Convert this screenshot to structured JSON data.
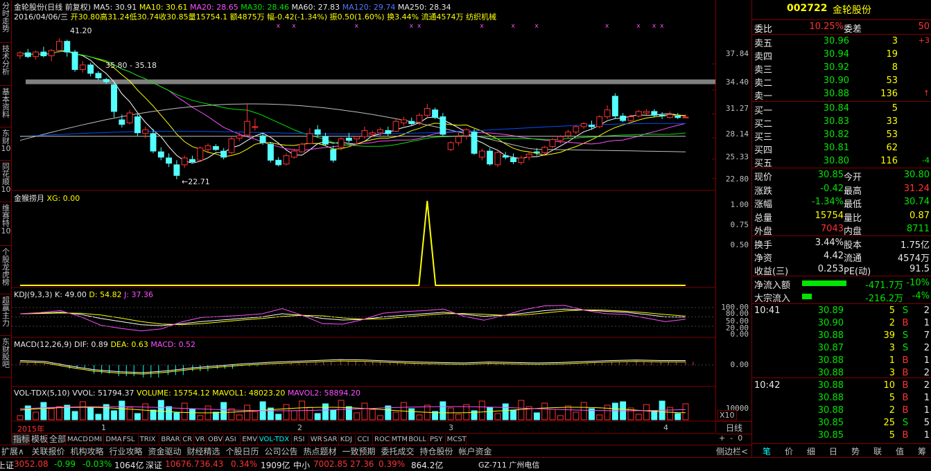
{
  "left_tabs": [
    "分时走势",
    "技术分析",
    "基本资料",
    "东财10",
    "同花顺10",
    "维赛特10",
    "个股龙虎榜",
    "超赢主力",
    "东财股吧"
  ],
  "main": {
    "title_prefix": "金轮股份(日线 前复权)",
    "ma5": "MA5: 30.91",
    "ma10": "MA10: 30.61",
    "ma20": "MA20: 28.65",
    "ma30": "MA30: 28.46",
    "ma60": "MA60: 27.83",
    "ma120": "MA120: 29.74",
    "ma250": "MA250: 28.34",
    "info_date": "2016/04/06/三",
    "info_open": "开30.80",
    "info_high": "高31.24",
    "info_low": "低30.74",
    "info_close": "收30.85",
    "info_vol": "量15754.1",
    "info_amt": "额4875万",
    "info_chg": "幅-0.42(-1.34%)",
    "info_amp": "振0.50(1.60%)",
    "info_turn": "换3.44%",
    "info_float": "流通4574万",
    "info_ind": "纺织机械",
    "annot_high": "41.20",
    "annot_range": "35.80 - 35.18",
    "annot_low": "←22.71",
    "y_labels": [
      "37.84",
      "34.40",
      "31.27",
      "28.14",
      "25.33",
      "22.80"
    ]
  },
  "panel_jh": {
    "title": "金猴捞月",
    "xg": "XG: 0.00",
    "y_labels": [
      "1.00",
      "0.75",
      "0.50"
    ]
  },
  "panel_kdj": {
    "title": "KDJ(9,3,3)",
    "k": "K: 49.00",
    "d": "D: 54.82",
    "j": "J: 37.36",
    "y_labels": [
      "100.00",
      "80.00",
      "50.00",
      "20.00",
      "0.00"
    ]
  },
  "panel_macd": {
    "title": "MACD(12,26,9)",
    "dif": "DIF: 0.89",
    "dea": "DEA: 0.63",
    "macd": "MACD: 0.52",
    "y_labels": [
      "0.00"
    ]
  },
  "panel_vol": {
    "title": "VOL-TDX(5,10)",
    "vvol": "VVOL: 51794.37",
    "volume": "VOLUME: 15754.12",
    "mavol1": "MAVOL1: 48023.20",
    "mavol2": "MAVOL2: 58894.20",
    "y_labels": [
      "10000"
    ],
    "unit": "X10"
  },
  "x_axis": [
    "2015年",
    "1",
    "2",
    "3",
    "4"
  ],
  "bottom_tabs": [
    "指标",
    "模板",
    "全部",
    "MACD",
    "DMI",
    "DMA",
    "FSL",
    "TRIX",
    "BRAR",
    "CR",
    "VR",
    "OBV",
    "ASI",
    "EMV",
    "VOL-TDX",
    "RSI",
    "WR",
    "SAR",
    "KDJ",
    "CCI",
    "ROC",
    "MTM",
    "BOLL",
    "PSY",
    "MCST"
  ],
  "period_label": "日线",
  "menu": [
    "扩展∧",
    "关联报价",
    "机构攻略",
    "行业攻略",
    "资金驱动",
    "财经精选",
    "个股日历",
    "公司公告",
    "热点题材",
    "一致预期",
    "委托成交",
    "持仓股份",
    "帐户资金"
  ],
  "menu_right": "侧边栏<",
  "stock": {
    "code": "002722",
    "name": "金轮股份"
  },
  "order_ratio": {
    "label1": "委比",
    "val1": "10.25%",
    "label2": "委差",
    "val2": "50"
  },
  "sells": [
    {
      "label": "卖五",
      "price": "30.96",
      "vol": "3",
      "chg": "+3"
    },
    {
      "label": "卖四",
      "price": "30.94",
      "vol": "19",
      "chg": ""
    },
    {
      "label": "卖三",
      "price": "30.92",
      "vol": "8",
      "chg": ""
    },
    {
      "label": "卖二",
      "price": "30.90",
      "vol": "53",
      "chg": ""
    },
    {
      "label": "卖一",
      "price": "30.88",
      "vol": "136",
      "chg": "↑"
    }
  ],
  "buys": [
    {
      "label": "买一",
      "price": "30.84",
      "vol": "5",
      "chg": ""
    },
    {
      "label": "买二",
      "price": "30.83",
      "vol": "33",
      "chg": ""
    },
    {
      "label": "买三",
      "price": "30.82",
      "vol": "53",
      "chg": ""
    },
    {
      "label": "买四",
      "price": "30.81",
      "vol": "62",
      "chg": ""
    },
    {
      "label": "买五",
      "price": "30.80",
      "vol": "116",
      "chg": "-4"
    }
  ],
  "quote": [
    {
      "l1": "现价",
      "v1": "30.85",
      "l2": "今开",
      "v2": "30.80"
    },
    {
      "l1": "涨跌",
      "v1": "-0.42",
      "l2": "最高",
      "v2": "31.24"
    },
    {
      "l1": "涨幅",
      "v1": "-1.34%",
      "l2": "最低",
      "v2": "30.74"
    },
    {
      "l1": "总量",
      "v1": "15754",
      "l2": "量比",
      "v2": "0.87"
    },
    {
      "l1": "外盘",
      "v1": "7043",
      "l2": "内盘",
      "v2": "8711"
    }
  ],
  "fund": [
    {
      "l1": "换手",
      "v1": "3.44%",
      "l2": "股本",
      "v2": "1.75亿"
    },
    {
      "l1": "净资",
      "v1": "4.42",
      "l2": "流通",
      "v2": "4574万"
    },
    {
      "l1": "收益(三)",
      "v1": "0.253",
      "l2": "PE(动)",
      "v2": "91.5"
    }
  ],
  "flows": [
    {
      "label": "净流入额",
      "value": "-471.7万",
      "pct": "-10%",
      "bar_fraction": 0.92
    },
    {
      "label": "大宗流入",
      "value": "-216.2万",
      "pct": "-4%",
      "bar_fraction": 0.2
    }
  ],
  "ticks": [
    {
      "time": "10:41",
      "price": "30.89",
      "vol": "5",
      "side": "S",
      "n": "2"
    },
    {
      "time": "",
      "price": "30.90",
      "vol": "2",
      "side": "B",
      "n": "1"
    },
    {
      "time": "",
      "price": "30.88",
      "vol": "39",
      "side": "S",
      "n": "7"
    },
    {
      "time": "",
      "price": "30.87",
      "vol": "3",
      "side": "S",
      "n": "2"
    },
    {
      "time": "",
      "price": "30.88",
      "vol": "1",
      "side": "B",
      "n": "1"
    },
    {
      "time": "",
      "price": "30.88",
      "vol": "3",
      "side": "B",
      "n": "2"
    },
    {
      "time": "10:42",
      "price": "30.88",
      "vol": "10",
      "side": "B",
      "n": "2"
    },
    {
      "time": "",
      "price": "30.88",
      "vol": "5",
      "side": "B",
      "n": "1"
    },
    {
      "time": "",
      "price": "30.88",
      "vol": "2",
      "side": "B",
      "n": "1"
    },
    {
      "time": "",
      "price": "30.85",
      "vol": "25",
      "side": "S",
      "n": "5"
    },
    {
      "time": "",
      "price": "30.85",
      "vol": "5",
      "side": "B",
      "n": "1"
    }
  ],
  "right_tabs": [
    "笔",
    "价",
    "细",
    "日",
    "势",
    "联",
    "值",
    "筹"
  ],
  "status": {
    "sh_label": "上证",
    "sh_val": "3052.08",
    "sh_chg": "-0.99",
    "sh_pct": "-0.03%",
    "sh_amt": "1064亿",
    "sz_label": "深证",
    "sz_val": "10676.7",
    "sz_chg": "36.43",
    "sz_pct": "0.34%",
    "sz_amt": "1909亿",
    "zx_label": "中小",
    "zx_val": "7002.85",
    "zx_chg": "27.36",
    "zx_pct": "0.39%",
    "zx_amt": "864.2亿",
    "server": "GZ-711 广州电信"
  },
  "colors": {
    "up": "#ff3232",
    "down": "#54ffff",
    "border": "#800000",
    "ma5": "#ffffff",
    "ma10": "#ffff00",
    "ma20": "#ff50ff",
    "ma30": "#00e600",
    "ma60": "#c0c0c0",
    "ma120": "#0050ff"
  },
  "chart_data": {
    "type": "candlestick",
    "title": "金轮股份(日线 前复权)",
    "ylim": [
      21.5,
      43.5
    ],
    "candles": [
      [
        38.9,
        39.5,
        38.5,
        39.3
      ],
      [
        39.3,
        39.8,
        38.6,
        38.8
      ],
      [
        38.8,
        39.6,
        38.4,
        39.4
      ],
      [
        39.4,
        40.1,
        38.7,
        38.9
      ],
      [
        38.9,
        39.8,
        38.2,
        39.6
      ],
      [
        39.6,
        41.2,
        39.3,
        40.8
      ],
      [
        40.8,
        41.0,
        38.8,
        39.4
      ],
      [
        39.4,
        39.7,
        36.8,
        37.1
      ],
      [
        37.1,
        38.2,
        36.7,
        37.7
      ],
      [
        37.7,
        38.0,
        36.2,
        36.6
      ],
      [
        36.6,
        36.9,
        35.7,
        36.0
      ],
      [
        35.8,
        36.0,
        35.2,
        35.5
      ],
      [
        35.1,
        35.3,
        30.8,
        31.6
      ],
      [
        30.5,
        31.2,
        29.5,
        29.9
      ],
      [
        30.1,
        31.8,
        29.9,
        31.4
      ],
      [
        30.9,
        31.3,
        28.4,
        28.8
      ],
      [
        28.7,
        29.6,
        28.1,
        29.2
      ],
      [
        28.7,
        29.3,
        26.1,
        26.4
      ],
      [
        26.3,
        26.9,
        25.2,
        25.6
      ],
      [
        25.5,
        26.1,
        24.3,
        24.8
      ],
      [
        24.6,
        25.2,
        22.7,
        23.2
      ],
      [
        24.6,
        25.8,
        24.2,
        25.5
      ],
      [
        25.3,
        25.8,
        24.8,
        25.0
      ],
      [
        25.2,
        27.0,
        25.0,
        26.8
      ],
      [
        26.6,
        27.4,
        26.3,
        27.1
      ],
      [
        27.0,
        27.3,
        26.4,
        26.6
      ],
      [
        26.4,
        26.8,
        25.3,
        25.6
      ],
      [
        26.2,
        28.4,
        26.0,
        28.0
      ],
      [
        28.1,
        28.8,
        27.7,
        28.4
      ],
      [
        28.5,
        32.6,
        28.4,
        30.3
      ],
      [
        29.5,
        30.7,
        29.1,
        29.6
      ],
      [
        28.4,
        28.7,
        27.2,
        27.5
      ],
      [
        27.3,
        27.6,
        24.9,
        25.2
      ],
      [
        25.2,
        25.6,
        24.4,
        24.6
      ],
      [
        24.7,
        26.1,
        24.5,
        25.8
      ],
      [
        25.6,
        26.7,
        25.4,
        26.4
      ],
      [
        26.3,
        27.5,
        26.2,
        27.3
      ],
      [
        27.4,
        29.4,
        27.3,
        28.7
      ],
      [
        29.2,
        29.8,
        28.2,
        28.6
      ],
      [
        28.3,
        28.8,
        27.1,
        27.3
      ],
      [
        26.6,
        27.1,
        24.9,
        25.2
      ],
      [
        26.9,
        28.2,
        26.5,
        28.0
      ],
      [
        28.1,
        28.8,
        27.5,
        27.8
      ],
      [
        28.0,
        28.4,
        27.1,
        28.3
      ],
      [
        28.3,
        29.6,
        28.0,
        29.1
      ],
      [
        28.6,
        29.1,
        28.2,
        28.8
      ],
      [
        28.8,
        29.5,
        28.3,
        29.2
      ],
      [
        29.1,
        29.6,
        28.4,
        28.7
      ],
      [
        29.0,
        30.6,
        28.9,
        30.3
      ],
      [
        30.1,
        30.9,
        29.7,
        30.5
      ],
      [
        30.3,
        30.8,
        29.8,
        30.0
      ],
      [
        30.2,
        31.4,
        29.8,
        31.1
      ],
      [
        31.1,
        32.6,
        30.8,
        32.0
      ],
      [
        31.8,
        32.1,
        30.6,
        30.8
      ],
      [
        30.9,
        31.4,
        28.4,
        28.6
      ],
      [
        26.6,
        27.7,
        26.4,
        27.5
      ],
      [
        27.5,
        28.8,
        27.1,
        28.3
      ],
      [
        28.4,
        29.4,
        27.9,
        29.2
      ],
      [
        28.9,
        29.3,
        25.9,
        26.1
      ],
      [
        25.6,
        26.7,
        25.2,
        26.4
      ],
      [
        26.4,
        26.8,
        24.5,
        24.7
      ],
      [
        24.6,
        26.5,
        24.3,
        26.2
      ],
      [
        25.8,
        26.3,
        25.3,
        25.6
      ],
      [
        25.5,
        26.1,
        24.7,
        25.0
      ],
      [
        24.9,
        25.8,
        24.6,
        25.5
      ],
      [
        25.6,
        26.4,
        25.2,
        26.0
      ],
      [
        26.3,
        26.8,
        25.8,
        26.2
      ],
      [
        26.2,
        27.1,
        25.9,
        26.9
      ],
      [
        27.0,
        28.1,
        26.8,
        27.9
      ],
      [
        27.8,
        28.5,
        27.4,
        28.3
      ],
      [
        28.4,
        29.2,
        28.1,
        28.9
      ],
      [
        28.9,
        29.8,
        28.6,
        29.6
      ],
      [
        29.6,
        30.2,
        29.3,
        30.0
      ],
      [
        29.8,
        30.4,
        29.2,
        29.6
      ],
      [
        29.6,
        31.1,
        29.4,
        30.9
      ],
      [
        30.9,
        32.4,
        30.6,
        31.8
      ],
      [
        33.6,
        34.0,
        30.6,
        31.0
      ],
      [
        31.0,
        31.4,
        30.2,
        30.4
      ],
      [
        30.4,
        31.2,
        30.1,
        30.9
      ],
      [
        31.0,
        31.8,
        30.8,
        31.6
      ],
      [
        31.4,
        31.9,
        31.1,
        31.6
      ],
      [
        31.6,
        31.9,
        30.8,
        31.1
      ],
      [
        31.1,
        31.5,
        30.6,
        31.0
      ],
      [
        30.8,
        31.6,
        30.7,
        31.2
      ],
      [
        31.0,
        31.4,
        30.6,
        30.8
      ],
      [
        30.8,
        31.24,
        30.74,
        30.85
      ]
    ],
    "ma_values": {
      "MA5": 30.91,
      "MA10": 30.61,
      "MA20": 28.65,
      "MA30": 28.46,
      "MA60": 27.83,
      "MA120": 29.74,
      "MA250": 28.34
    },
    "kdj": {
      "K": 49.0,
      "D": 54.82,
      "J": 37.36,
      "k_series": [
        60,
        62,
        65,
        58,
        45,
        35,
        25,
        22,
        28,
        35,
        40,
        45,
        50,
        60,
        55,
        45,
        40,
        42,
        50,
        55,
        60,
        65,
        58,
        52,
        55,
        62,
        70,
        75,
        72,
        68,
        65,
        58,
        50,
        49
      ]
    },
    "macd": {
      "DIF": 0.89,
      "DEA": 0.63,
      "MACD": 0.52,
      "hist": [
        0.5,
        0.3,
        -0.6,
        -1.4,
        -1.8,
        -2.0,
        -1.6,
        -1.0,
        -0.6,
        -0.2,
        0.1,
        0.3,
        0.5,
        0.7,
        0.6,
        0.4,
        0.2,
        0.1,
        0.0,
        0.2,
        0.1,
        0.0,
        0.1,
        0.3,
        0.5,
        0.6,
        0.5,
        0.5
      ]
    },
    "volume": {
      "VOLUME": 15754.12,
      "MAVOL1": 48023.2,
      "MAVOL2": 58894.2
    }
  }
}
